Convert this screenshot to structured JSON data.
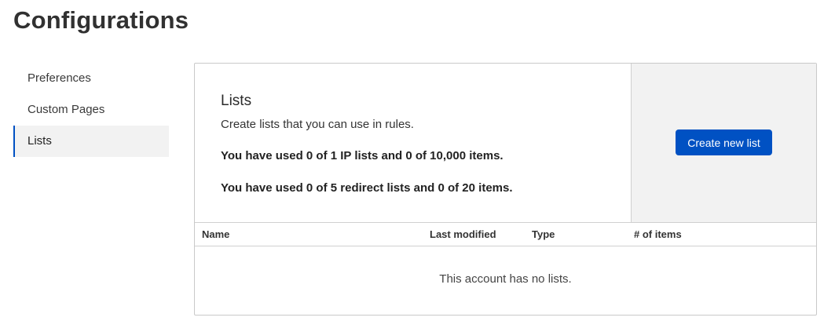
{
  "page": {
    "title": "Configurations"
  },
  "sidebar": {
    "items": [
      {
        "label": "Preferences",
        "active": false
      },
      {
        "label": "Custom Pages",
        "active": false
      },
      {
        "label": "Lists",
        "active": true
      }
    ]
  },
  "lists_section": {
    "title": "Lists",
    "description": "Create lists that you can use in rules.",
    "usage_ip": "You have used 0 of 1 IP lists and 0 of 10,000 items.",
    "usage_redirect": "You have used 0 of 5 redirect lists and 0 of 20 items.",
    "create_button_label": "Create new list"
  },
  "table": {
    "columns": [
      "Name",
      "Last modified",
      "Type",
      "# of items"
    ],
    "rows": [],
    "empty_message": "This account has no lists."
  },
  "colors": {
    "accent": "#0051c3",
    "panel_bg": "#f2f2f2",
    "border": "#c9c9c9"
  }
}
